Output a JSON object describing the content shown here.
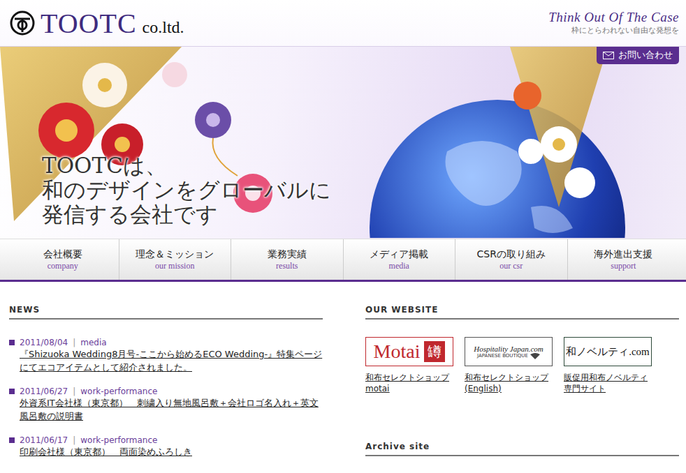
{
  "header": {
    "logo": "TOOTC",
    "logo_suffix": "co.ltd.",
    "tagline": "Think Out Of The Case",
    "subtagline": "枠にとらわれない自由な発想を"
  },
  "contact_button": "お問い合わせ",
  "hero": {
    "lines": [
      "TOOTCは、",
      "和のデザインをグローバルに",
      "発信する会社です"
    ]
  },
  "nav": [
    {
      "ja": "会社概要",
      "en": "company"
    },
    {
      "ja": "理念＆ミッション",
      "en": "our mission"
    },
    {
      "ja": "業務実績",
      "en": "results"
    },
    {
      "ja": "メディア掲載",
      "en": "media"
    },
    {
      "ja": "CSRの取り組み",
      "en": "our csr"
    },
    {
      "ja": "海外進出支援",
      "en": "support"
    }
  ],
  "news": {
    "heading": "NEWS",
    "items": [
      {
        "date": "2011/08/04",
        "separator": "|",
        "category": "media",
        "title": "『Shizuoka Wedding8月号-ここから始めるECO Wedding-』特集ページにてエコアイテムとして紹介されました。"
      },
      {
        "date": "2011/06/27",
        "separator": "|",
        "category": "work-performance",
        "title": "外資系IT会社様（東京都）　刺繍入り無地風呂敷＋会社ロゴ名入れ＋英文風呂敷の説明書"
      },
      {
        "date": "2011/06/17",
        "separator": "|",
        "category": "work-performance",
        "title": "印刷会社様（東京都）　両面染めふろしき"
      }
    ]
  },
  "websites": {
    "heading": "OUR WEBSITE",
    "items": [
      {
        "kind": "motai",
        "logo": [
          "Motai",
          "罇"
        ],
        "caption": [
          "和布セレクトショップ",
          "motai"
        ]
      },
      {
        "kind": "hospitality",
        "logo": [
          "Hospitality Japan.com",
          "JAPANESE BOUTIQUE"
        ],
        "caption": [
          "和布セレクトショップ",
          "(English)"
        ]
      },
      {
        "kind": "novelty",
        "logo": [
          "和ノベルティ.com"
        ],
        "caption": [
          "販促用和布ノベルティ",
          "専門サイト"
        ]
      }
    ]
  },
  "archive": {
    "heading": "Archive site"
  }
}
